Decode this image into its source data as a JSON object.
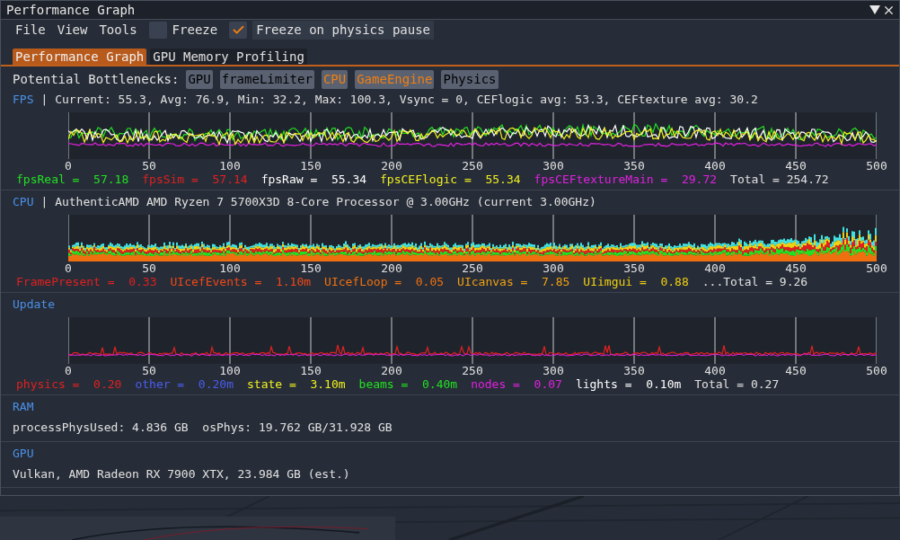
{
  "window": {
    "title": "Performance Graph"
  },
  "menu": [
    "File",
    "View",
    "Tools"
  ],
  "toggles": [
    {
      "label": "Freeze",
      "checked": false
    },
    {
      "label": "Freeze on physics pause",
      "checked": true
    }
  ],
  "tabs": [
    {
      "label": "Performance Graph",
      "selected": true
    },
    {
      "label": "GPU Memory Profiling",
      "selected": false
    }
  ],
  "bottlenecks": {
    "label": "Potential Bottlenecks:",
    "items": [
      {
        "name": "GPU",
        "color": "#000000"
      },
      {
        "name": "frameLimiter",
        "color": "#000000"
      },
      {
        "name": "CPU",
        "color": "#f07f10"
      },
      {
        "name": "GameEngine",
        "color": "#f07f10"
      },
      {
        "name": "Physics",
        "color": "#000000"
      }
    ]
  },
  "sections": [
    {
      "title": "FPS",
      "info": "| Current: 55.3, Avg: 76.9, Min: 32.2, Max: 100.3, Vsync = 0, CEFlogic avg: 53.3, CEFtexture avg: 30.2",
      "graph": {
        "kind": "lines",
        "axis_labels": [
          "0",
          "50",
          "100",
          "150",
          "200",
          "250",
          "300",
          "350",
          "400",
          "450",
          "500"
        ]
      },
      "legend": [
        {
          "name": "fpsReal =",
          "value": "57.18",
          "color": "#22e022"
        },
        {
          "name": "fpsSim =",
          "value": "57.14",
          "color": "#e02020"
        },
        {
          "name": "fpsRaw =",
          "value": "55.34",
          "color": "#ffffff"
        },
        {
          "name": "fpsCEFlogic =",
          "value": "55.34",
          "color": "#f0f020"
        },
        {
          "name": "fpsCEFtextureMain =",
          "value": "29.72",
          "color": "#e020e0"
        }
      ],
      "total": "Total = 254.72"
    },
    {
      "title": "CPU",
      "info": "| AuthenticAMD AMD Ryzen 7 5700X3D 8-Core Processor @ 3.00GHz (current 3.00GHz)",
      "graph": {
        "kind": "bars",
        "axis_labels": [
          "0",
          "50",
          "100",
          "150",
          "200",
          "250",
          "300",
          "350",
          "400",
          "450",
          "500"
        ]
      },
      "legend": [
        {
          "name": "FramePresent =",
          "value": "0.33",
          "color": "#e02020"
        },
        {
          "name": "UIcefEvents =",
          "value": "1.10m",
          "color": "#f04818"
        },
        {
          "name": "UIcefLoop =",
          "value": "0.05",
          "color": "#f07010"
        },
        {
          "name": "UIcanvas =",
          "value": "7.85",
          "color": "#f0a010"
        },
        {
          "name": "UIimgui =",
          "value": "0.88",
          "color": "#f0d010"
        }
      ],
      "total": "...Total = 9.26"
    },
    {
      "title": "Update",
      "graph": {
        "kind": "spikes",
        "axis_labels": [
          "0",
          "50",
          "100",
          "150",
          "200",
          "250",
          "300",
          "350",
          "400",
          "450",
          "500"
        ]
      },
      "legend": [
        {
          "name": "physics =",
          "value": "0.20",
          "color": "#e02020"
        },
        {
          "name": "other =",
          "value": "0.20m",
          "color": "#4a5cf0"
        },
        {
          "name": "state =",
          "value": "3.10m",
          "color": "#f0f020"
        },
        {
          "name": "beams =",
          "value": "0.40m",
          "color": "#22e022"
        },
        {
          "name": "nodes =",
          "value": "0.07",
          "color": "#e020e0"
        },
        {
          "name": "lights =",
          "value": "0.10m",
          "color": "#ffffff"
        }
      ],
      "total": "Total = 0.27"
    },
    {
      "title": "RAM",
      "lines": [
        "processPhysUsed: 4.836 GB  osPhys: 19.762 GB/31.928 GB"
      ]
    },
    {
      "title": "GPU",
      "lines": [
        "Vulkan, AMD Radeon RX 7900 XTX, 23.984 GB (est.)"
      ]
    }
  ]
}
